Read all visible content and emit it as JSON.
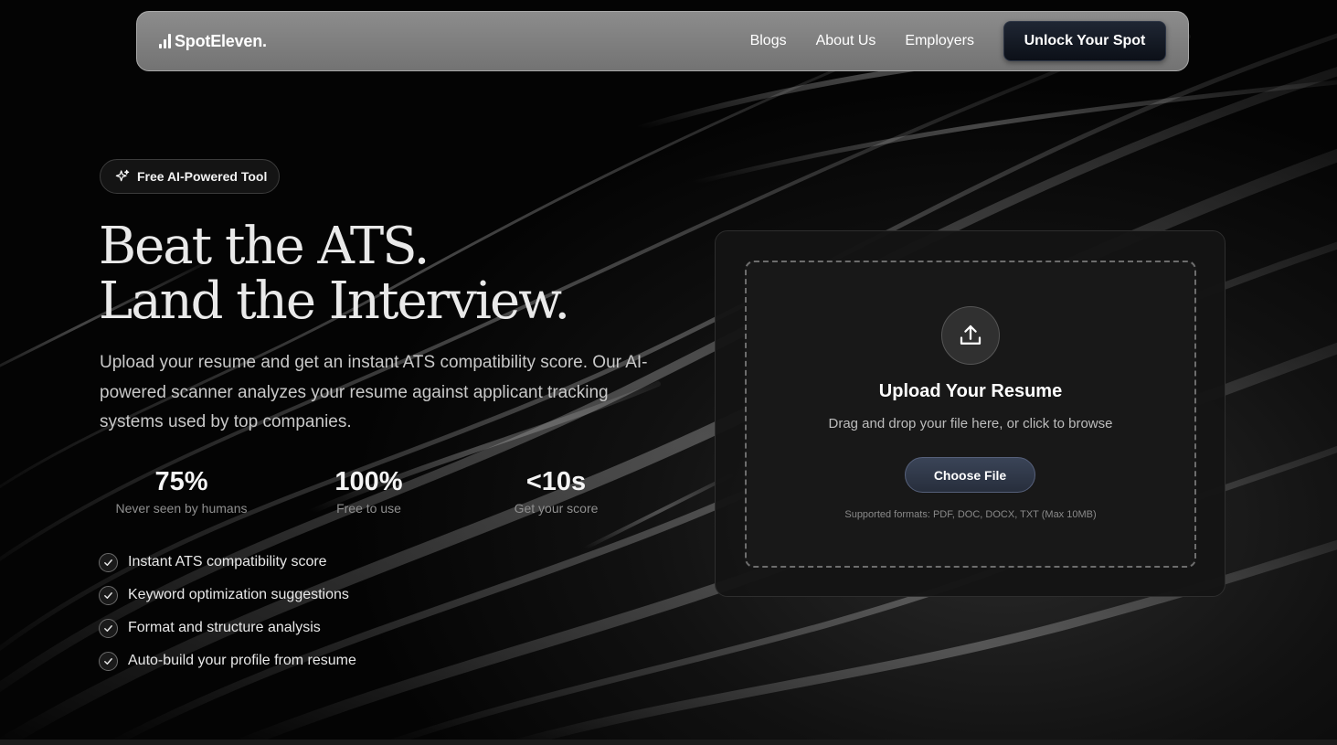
{
  "nav": {
    "logo": "SpotEleven.",
    "links": [
      "Blogs",
      "About Us",
      "Employers"
    ],
    "cta": "Unlock Your Spot"
  },
  "hero": {
    "badge": "Free AI-Powered Tool",
    "headline_line1": "Beat the ATS.",
    "headline_line2": "Land the Interview.",
    "lead": "Upload your resume and get an instant ATS compatibility score. Our AI-powered scanner analyzes your resume against applicant tracking systems used by top companies.",
    "stats": [
      {
        "value": "75%",
        "label": "Never seen by humans"
      },
      {
        "value": "100%",
        "label": "Free to use"
      },
      {
        "value": "<10s",
        "label": "Get your score"
      }
    ],
    "features": [
      "Instant ATS compatibility score",
      "Keyword optimization suggestions",
      "Format and structure analysis",
      "Auto-build your profile from resume"
    ]
  },
  "upload": {
    "icon": "upload-icon",
    "title": "Upload Your Resume",
    "subtitle": "Drag and drop your file here, or click to browse",
    "button": "Choose File",
    "formats": "Supported formats: PDF, DOC, DOCX, TXT (Max 10MB)"
  },
  "colors": {
    "background": "#050505",
    "nav_bg": "#808080",
    "cta_bg": "#151b26",
    "card_bg": "#141414",
    "choose_button": "#2f3747"
  }
}
